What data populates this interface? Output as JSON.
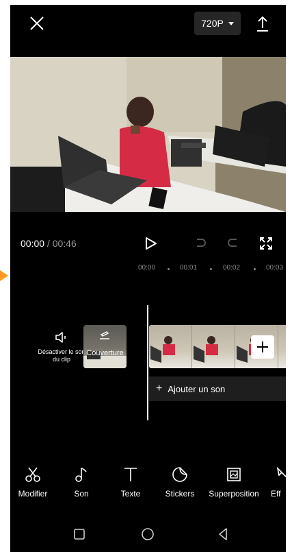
{
  "header": {
    "resolution_label": "720P"
  },
  "playback": {
    "current_time": "00:00",
    "separator": " / ",
    "total_time": "00:46"
  },
  "timeline": {
    "ticks": [
      "00:00",
      "00:01",
      "00:02",
      "00:03"
    ],
    "mute_label": "Désactiver le son du clip",
    "cover_label": "Couverture",
    "add_audio_label": "Ajouter un son"
  },
  "toolbar": {
    "items": [
      {
        "label": "Modifier",
        "icon": "scissors-icon"
      },
      {
        "label": "Son",
        "icon": "music-note-icon"
      },
      {
        "label": "Texte",
        "icon": "text-icon"
      },
      {
        "label": "Stickers",
        "icon": "sticker-icon"
      },
      {
        "label": "Superposition",
        "icon": "overlay-icon"
      },
      {
        "label": "Eff",
        "icon": "effects-icon"
      }
    ]
  },
  "colors": {
    "background": "#000000",
    "accent": "#ff9a1f"
  }
}
